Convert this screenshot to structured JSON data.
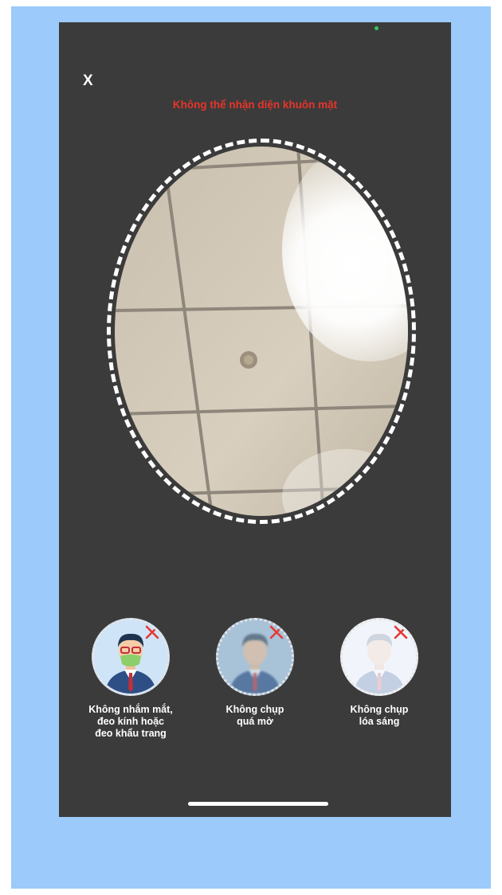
{
  "screen": {
    "close_label": "X",
    "error_title": "Không thể nhận diện khuôn mặt"
  },
  "guides": [
    {
      "label": "Không nhắm mắt,\nđeo kính hoặc\nđeo khẩu trang",
      "icon": "person-with-glasses-and-mask-icon"
    },
    {
      "label": "Không chụp\nquá mờ",
      "icon": "blurry-person-icon"
    },
    {
      "label": "Không chụp\nlóa sáng",
      "icon": "overexposed-person-icon"
    }
  ],
  "colors": {
    "background": "#9bcafb",
    "screen": "#3b3b3b",
    "error_text": "#e8342a",
    "cross": "#e53935"
  }
}
